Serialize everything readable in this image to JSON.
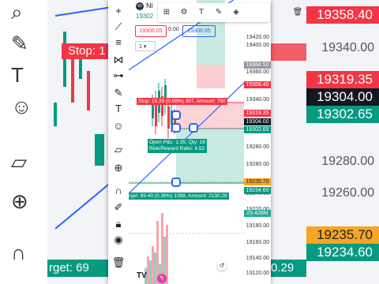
{
  "background": {
    "prices": {
      "p19358_40": "19358.40",
      "p19340": "19340.00",
      "p19319_35": "19319.35",
      "p19304": "19304.00",
      "p19302_65": "19302.65",
      "p19280": "19280.00",
      "p19260": "19260.00",
      "p19235_70": "19235.70",
      "p19234_60": "19234.60"
    },
    "stop_text": "Stop: 1",
    "target_text": "rget: 69",
    "right_tail": "0.29"
  },
  "symbol": {
    "name": "Ni",
    "last_price": "19302",
    "badge": "50"
  },
  "order_bar": {
    "sell_price": "19306.05",
    "spread": "0.00",
    "buy_price": "19306.05",
    "quantity": "1"
  },
  "axis": {
    "ticks": [
      "19420.00",
      "19400.00",
      "19380.00",
      "19360.00",
      "19340.00",
      "19320.00",
      "19300.00",
      "19280.00",
      "19260.00",
      "19240.00",
      "19220.00",
      "19200.00",
      "19180.00",
      "19160.00",
      "19140.00",
      "19120.00"
    ],
    "badges": {
      "b19384": "19384.50",
      "b19358": "19358.40",
      "b19319": "19319.35",
      "b19304": "19304.00",
      "b19302": "19302.65",
      "b19235": "19235.70",
      "b19234": "19234.60",
      "volume": "23.428M"
    }
  },
  "position": {
    "stop_label": "Stop: 15.35 (0.08%) 307, Amount: 750",
    "pnl_line1": "Open P&L: 1.35, Qty: 16",
    "pnl_line2": "Risk/Reward Ratio: 4.52",
    "target_label": "rget: 69.40 (0.36%) 1388, Amount: 2130.29"
  },
  "colors": {
    "red": "#f23645",
    "green": "#089981",
    "teal": "#22ab94",
    "orange": "#f5a623",
    "blue": "#2962ff",
    "dark": "#131722"
  },
  "icons": {
    "plus": "plus-icon",
    "magnet": "magnet-icon",
    "ruler": "ruler-icon",
    "zoom": "zoom-icon",
    "trash": "trash-icon",
    "eye": "eye-icon",
    "lock": "lock-icon",
    "undo": "undo-icon",
    "logo": "tradingview-logo"
  }
}
